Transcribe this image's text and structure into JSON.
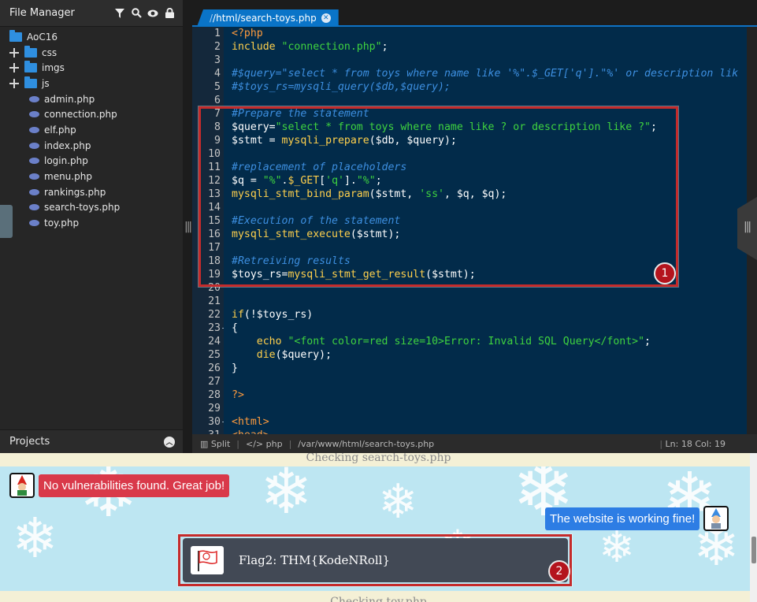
{
  "file_manager": {
    "title": "File Manager",
    "root_folder": "AoC16",
    "folders": [
      "css",
      "imgs",
      "js"
    ],
    "files": [
      "admin.php",
      "connection.php",
      "elf.php",
      "index.php",
      "login.php",
      "menu.php",
      "rankings.php",
      "search-toys.php",
      "toy.php"
    ],
    "projects_label": "Projects"
  },
  "editor": {
    "tab_prefix": "/",
    "tab_path": "/html/search-toys.php",
    "lines": [
      {
        "n": "1",
        "segs": [
          [
            "c-tag",
            "<?php"
          ]
        ]
      },
      {
        "n": "2",
        "segs": [
          [
            "c-kw",
            "include "
          ],
          [
            "c-str",
            "\"connection.php\""
          ],
          [
            "",
            ";"
          ]
        ]
      },
      {
        "n": "3",
        "segs": []
      },
      {
        "n": "4",
        "segs": [
          [
            "c-cm",
            "#$query=\"select * from toys where name like '%\".$_GET['q'].\"%' or description lik"
          ]
        ]
      },
      {
        "n": "5",
        "segs": [
          [
            "c-cm",
            "#$toys_rs=mysqli_query($db,$query);"
          ]
        ]
      },
      {
        "n": "6",
        "segs": []
      },
      {
        "n": "7",
        "segs": [
          [
            "c-cm",
            "#Prepare the statement"
          ]
        ]
      },
      {
        "n": "8",
        "segs": [
          [
            "",
            "$query="
          ],
          [
            "c-str",
            "\"select * from toys where name like ? or description like ?\""
          ],
          [
            "",
            ";"
          ]
        ]
      },
      {
        "n": "9",
        "segs": [
          [
            "",
            "$stmt = "
          ],
          [
            "c-kw",
            "mysqli_prepare"
          ],
          [
            "",
            "($db, $query);"
          ]
        ]
      },
      {
        "n": "10",
        "segs": []
      },
      {
        "n": "11",
        "segs": [
          [
            "c-cm",
            "#replacement of placeholders"
          ]
        ]
      },
      {
        "n": "12",
        "segs": [
          [
            "",
            "$q = "
          ],
          [
            "c-str",
            "\"%\""
          ],
          [
            "",
            "."
          ],
          [
            "c-kw",
            "$_GET"
          ],
          [
            "",
            "["
          ],
          [
            "c-str",
            "'q'"
          ],
          [
            "",
            "]."
          ],
          [
            "c-str",
            "\"%\""
          ],
          [
            "",
            ";"
          ]
        ]
      },
      {
        "n": "13",
        "segs": [
          [
            "c-kw",
            "mysqli_stmt_bind_param"
          ],
          [
            "",
            "($stmt, "
          ],
          [
            "c-str",
            "'ss'"
          ],
          [
            "",
            ", $q, $q);"
          ]
        ]
      },
      {
        "n": "14",
        "segs": []
      },
      {
        "n": "15",
        "segs": [
          [
            "c-cm",
            "#Execution of the statement"
          ]
        ]
      },
      {
        "n": "16",
        "segs": [
          [
            "c-kw",
            "mysqli_stmt_execute"
          ],
          [
            "",
            "($stmt);"
          ]
        ]
      },
      {
        "n": "17",
        "segs": []
      },
      {
        "n": "18",
        "segs": [
          [
            "c-cm",
            "#Retreiving results"
          ]
        ]
      },
      {
        "n": "19",
        "segs": [
          [
            "",
            "$toys_rs="
          ],
          [
            "c-kw",
            "mysqli_stmt_get_result"
          ],
          [
            "",
            "($stmt);"
          ]
        ]
      },
      {
        "n": "20",
        "segs": []
      },
      {
        "n": "21",
        "segs": []
      },
      {
        "n": "22",
        "segs": [
          [
            "c-kw",
            "if"
          ],
          [
            "",
            "(!$toys_rs)"
          ]
        ]
      },
      {
        "n": "23",
        "segs": [
          [
            "",
            "{"
          ]
        ]
      },
      {
        "n": "24",
        "segs": [
          [
            "",
            "    "
          ],
          [
            "c-kw",
            "echo "
          ],
          [
            "c-str",
            "\"<font color=red size=10>Error: Invalid SQL Query</font>\""
          ],
          [
            "",
            ";"
          ]
        ]
      },
      {
        "n": "25",
        "segs": [
          [
            "",
            "    "
          ],
          [
            "c-kw",
            "die"
          ],
          [
            "",
            "($query);"
          ]
        ]
      },
      {
        "n": "26",
        "segs": [
          [
            "",
            "}"
          ]
        ]
      },
      {
        "n": "27",
        "segs": []
      },
      {
        "n": "28",
        "segs": [
          [
            "c-tag",
            "?>"
          ]
        ]
      },
      {
        "n": "29",
        "segs": []
      },
      {
        "n": "30",
        "segs": [
          [
            "c-tag",
            "<html>"
          ]
        ]
      },
      {
        "n": "31",
        "segs": [
          [
            "c-tag",
            "<head>"
          ]
        ]
      }
    ],
    "fold_lines": [
      "23",
      "30",
      "31"
    ],
    "status": {
      "split": "Split",
      "lang": "php",
      "path": "/var/www/html/search-toys.php",
      "position": "Ln: 18 Col: 19"
    },
    "callout_1": "1"
  },
  "results": {
    "checking_top": "Checking search-toys.php",
    "no_vuln_msg": "No vulnerabilities found. Great job!",
    "website_msg": "The website is working fine!",
    "flag_text": "Flag2: THM{KodeNRoll}",
    "callout_2": "2",
    "checking_bottom": "Checking toy.php"
  }
}
